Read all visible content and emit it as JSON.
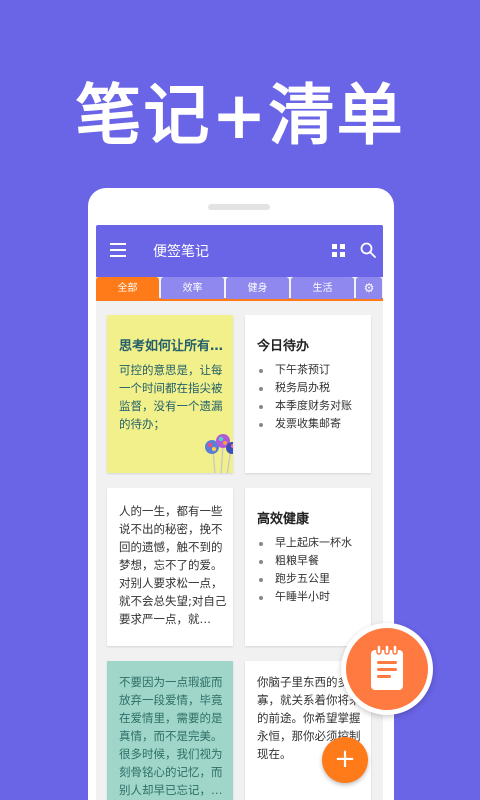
{
  "hero": {
    "title": "笔记+清单"
  },
  "app": {
    "title": "便签笔记",
    "icons": {
      "menu": "menu-icon",
      "grid": "grid-view-icon",
      "search": "search-icon",
      "settings": "gear-icon"
    }
  },
  "tabs": [
    {
      "label": "全部",
      "active": true
    },
    {
      "label": "效率",
      "active": false
    },
    {
      "label": "健身",
      "active": false
    },
    {
      "label": "生活",
      "active": false
    }
  ],
  "notes": {
    "note1": {
      "title": "思考如何让所有…",
      "body": "可控的意思是，让每一个时间都在指尖被监督，没有一个遗漏的待办；",
      "color": "#f2f08a"
    },
    "note2": {
      "title": "今日待办",
      "items": [
        "下午茶预订",
        "税务局办税",
        "本季度财务对账",
        "发票收集邮寄"
      ]
    },
    "note3": {
      "body": "人的一生，都有一些说不出的秘密，挽不回的遗憾，触不到的梦想，忘不了的爱。对别人要求松一点，就不会总失望;对自己要求严一点，就…"
    },
    "note4": {
      "title": "高效健康",
      "items": [
        "早上起床一杯水",
        "粗粮早餐",
        "跑步五公里",
        "午睡半小时"
      ]
    },
    "note5": {
      "body": "不要因为一点瑕疵而放弃一段爱情，毕竟在爱情里，需要的是真情，而不是完美。很多时候，我们视为刻骨铭心的记忆，而别人却早已忘记，…",
      "color": "#9fd6c9"
    },
    "note6": {
      "body": "你脑子里东西的多寡，就关系着你将来的前途。你希望掌握永恒，那你必须控制现在。"
    }
  },
  "fab": {
    "add_label": "+",
    "note_icon": "notepad-icon"
  },
  "colors": {
    "brand": "#6a64e6",
    "accent": "#ff7a18",
    "tab_inactive": "#8f88ee"
  }
}
